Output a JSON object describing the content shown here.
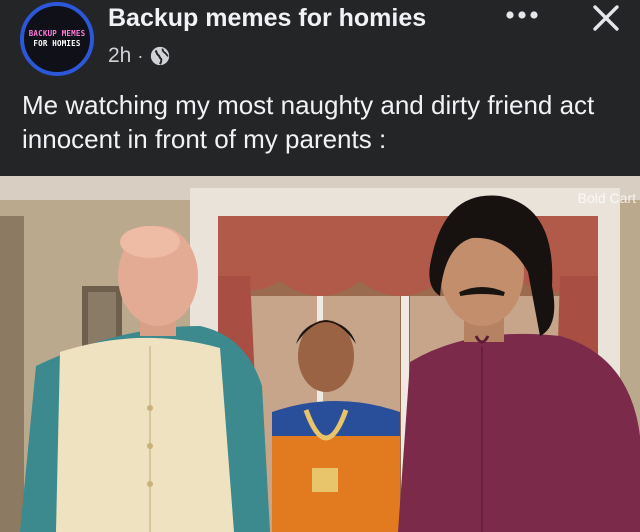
{
  "post": {
    "page_name": "Backup memes for homies",
    "time": "2h",
    "separator": "·",
    "privacy_icon": "globe-icon",
    "caption": "Me watching my most naughty and dirty friend act innocent in front of my parents :",
    "avatar_text": [
      "BACKUP MEMES",
      "FOR HOMIES"
    ],
    "more_icon": "more-horizontal-icon",
    "close_icon": "close-icon"
  },
  "image": {
    "watermark": "Bold Cart",
    "description_icons": "photo-meme"
  },
  "colors": {
    "background": "#242526",
    "avatar_ring": "#2b57d8",
    "text": "#e4e6eb"
  }
}
